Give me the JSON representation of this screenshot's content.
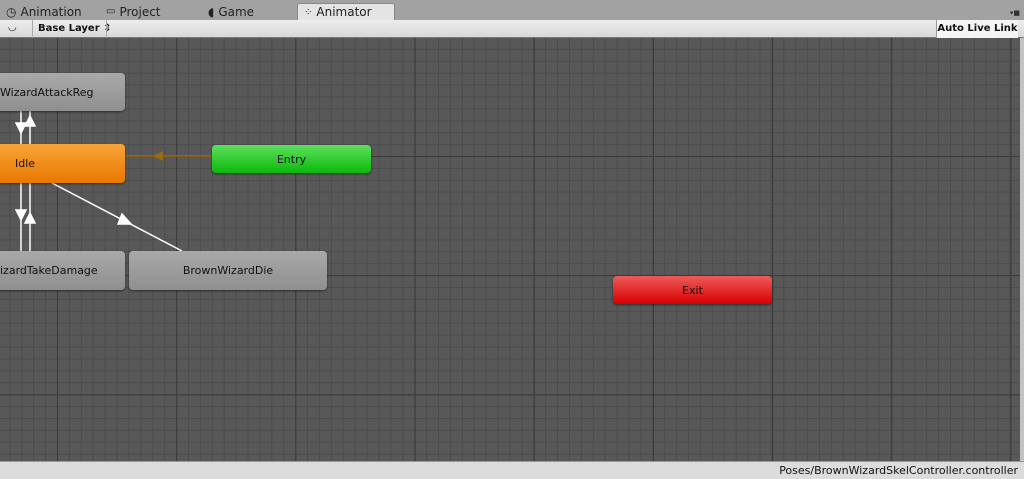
{
  "tabs": [
    {
      "label": "Animation",
      "icon": "clock-icon"
    },
    {
      "label": "Project",
      "icon": "folder-icon"
    },
    {
      "label": "Game",
      "icon": "pacman-icon"
    },
    {
      "label": "Animator",
      "icon": "animator-icon",
      "active": true
    }
  ],
  "toolbar": {
    "layer": "Base Layer",
    "auto_live_link": "Auto Live Link"
  },
  "nodes": {
    "attack": "WizardAttackReg",
    "idle": "Idle",
    "entry": "Entry",
    "take_damage": "izardTakeDamage",
    "die": "BrownWizardDie",
    "exit": "Exit"
  },
  "status": {
    "path": "Poses/BrownWizardSkelController.controller"
  },
  "colors": {
    "idle": "#f08a00",
    "entry": "#1fc11f",
    "exit": "#e0080a",
    "default": "#9a9a9a"
  }
}
